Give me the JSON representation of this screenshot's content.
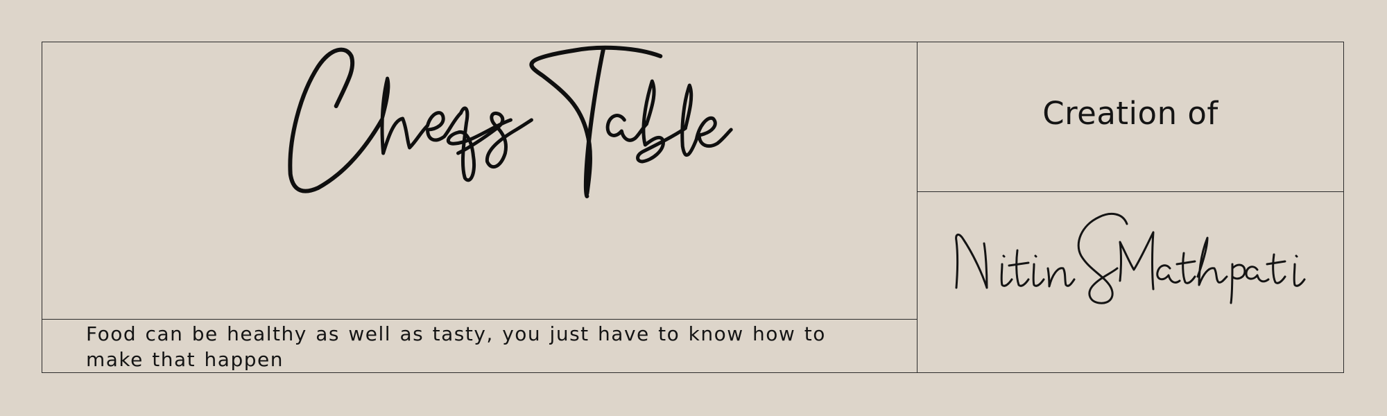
{
  "title": "Chefs Table",
  "tagline": "Food can be healthy as well as tasty, you just have to know how to make that happen",
  "creation_label": "Creation of",
  "author_signature": "Nitin S Mathpati",
  "colors": {
    "background": "#ddd5ca",
    "ink": "#111111",
    "rule": "#2a2a2a"
  }
}
